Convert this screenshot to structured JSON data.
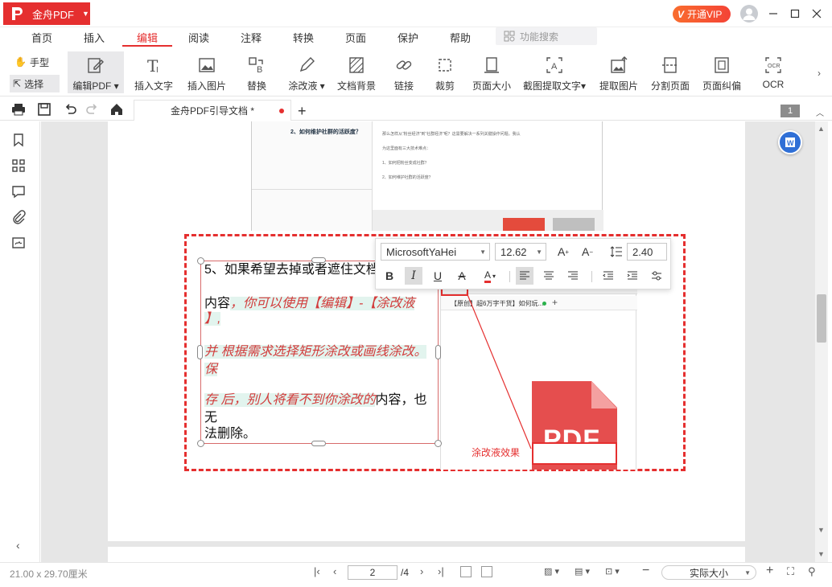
{
  "app": {
    "name": "金舟PDF",
    "vip_label": "开通VIP"
  },
  "menu": {
    "tabs": [
      "首页",
      "插入",
      "编辑",
      "阅读",
      "注释",
      "转换",
      "页面",
      "保护",
      "帮助"
    ],
    "search_placeholder": "功能搜索"
  },
  "ribbon": {
    "hand": "手型",
    "select": "选择",
    "buttons": [
      "编辑PDF",
      "插入文字",
      "插入图片",
      "替换",
      "涂改液",
      "文档背景",
      "链接",
      "裁剪",
      "页面大小",
      "截图提取文字",
      "提取图片",
      "分割页面",
      "页面纠偏",
      "OCR"
    ]
  },
  "doc": {
    "tab_title": "金舟PDF引导文档 *",
    "page_badge": "1"
  },
  "shot": {
    "heading": "2、如何维护社群的活跃度？",
    "line1": "那么怎样从“粉丝经济”到“社群经济”呢？这需要解决一系列关键操作问题。我认",
    "line2": "为这里面有三大技术难点：",
    "line3": "1、如何把粉丝变成社群？",
    "line4": "2、如何维护社群的活跃度？"
  },
  "editor": {
    "p1": "5、如果希望去掉或者遮住文档",
    "p2a": "内容",
    "p2b": "，你可以使用【编辑】-【涂改液",
    "p2c": "】,",
    "p3": "并 根据需求选择矩形涂改或画线涂改。保",
    "p4a": "存 后，别人将看不到你涂改的",
    "p4b": "内容，也无",
    "p5": "法删除。"
  },
  "inner": {
    "tabtitle": "【原创】超6万字干货】如何玩...",
    "annotation": "涂改液效果",
    "pdf_text": "PDF"
  },
  "format": {
    "font": "MicrosoftYaHei",
    "size": "12.62",
    "line_spacing": "2.40"
  },
  "status": {
    "size": "21.00 x 29.70厘米",
    "page": "2",
    "total": "/4",
    "zoom": "实际大小"
  },
  "colors": {
    "accent": "#e52f2f"
  }
}
